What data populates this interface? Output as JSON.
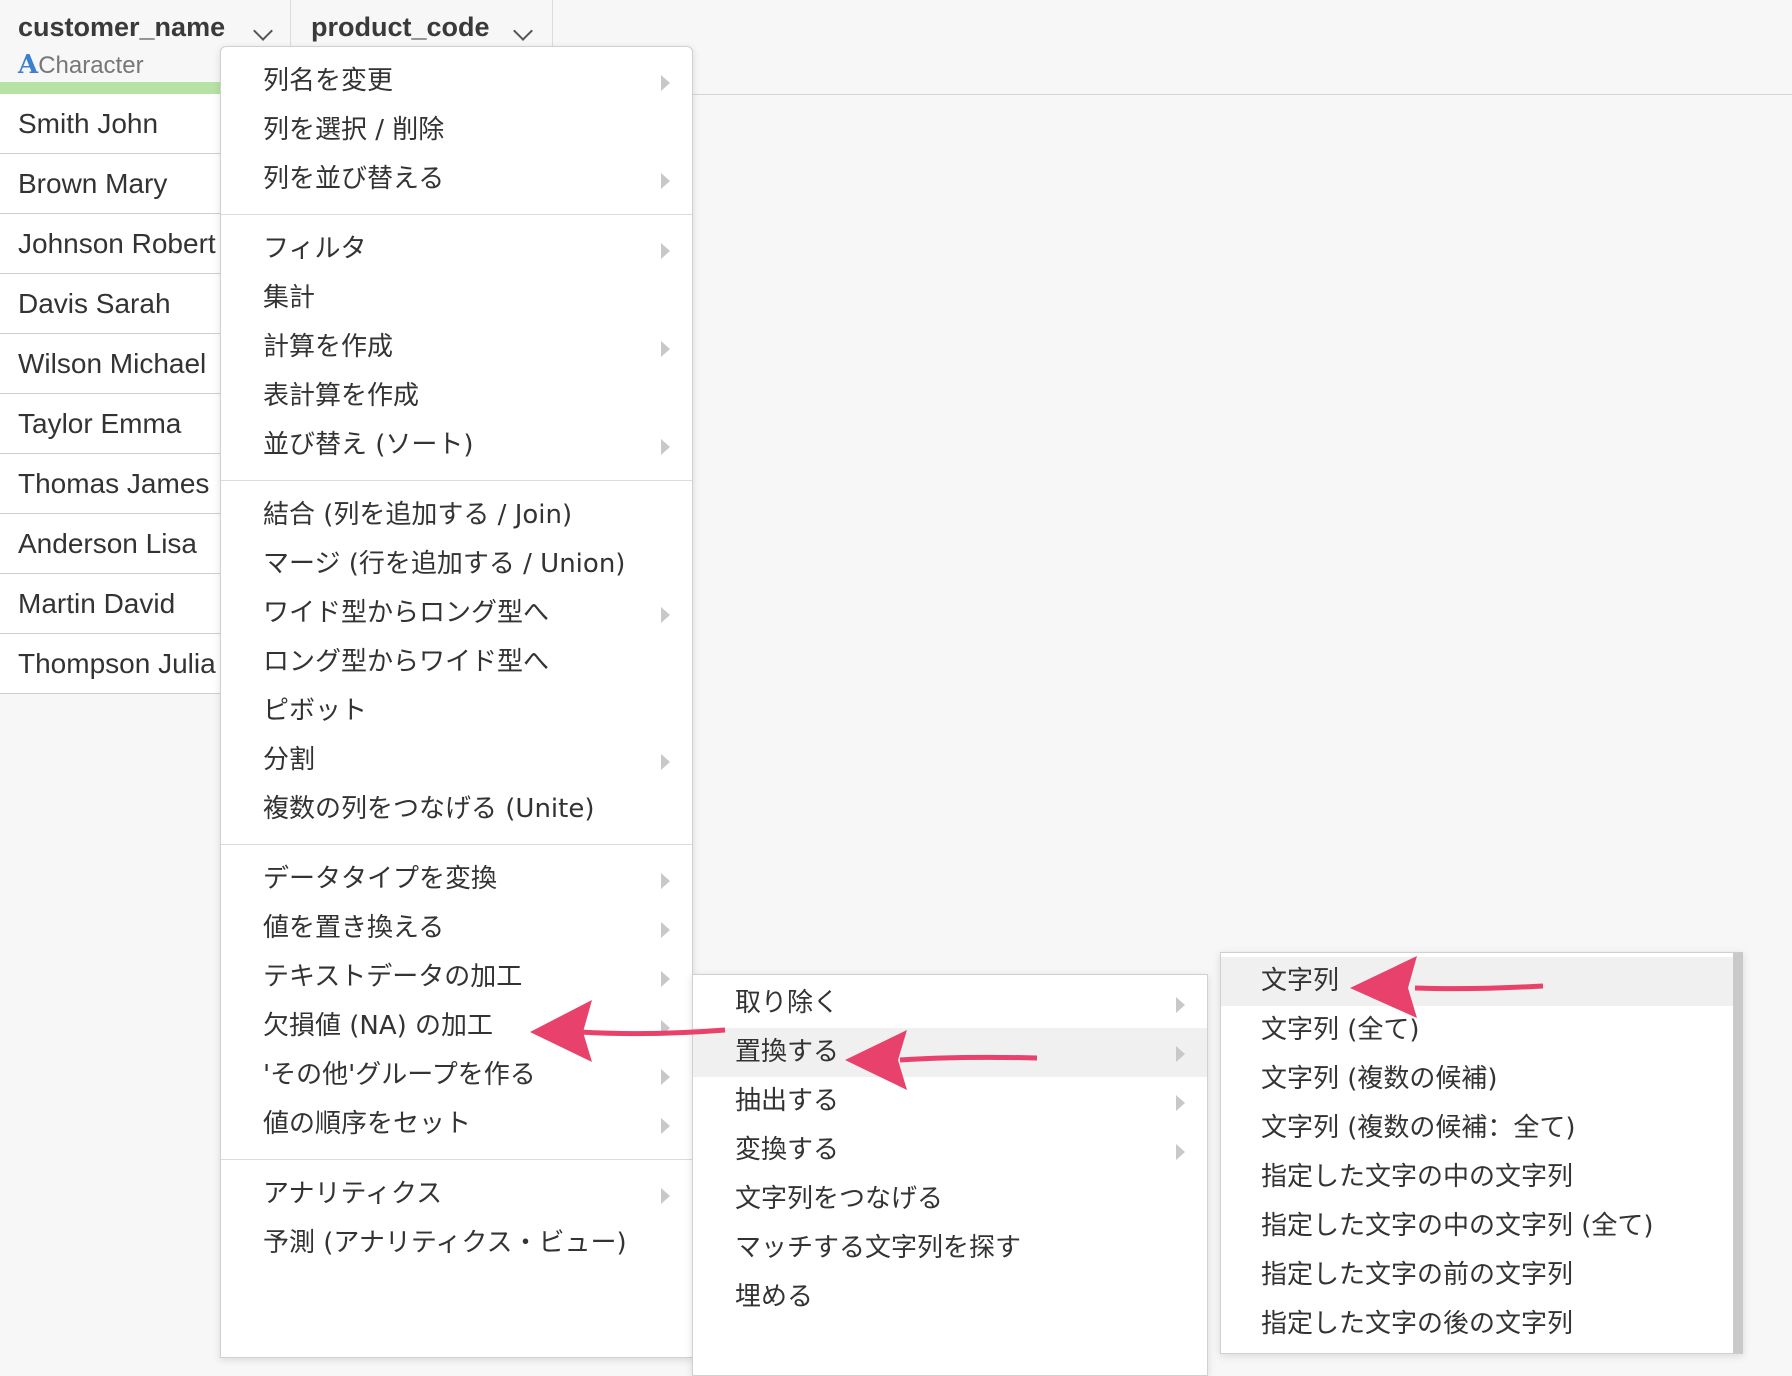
{
  "columns": [
    {
      "name": "customer_name",
      "type": "Character",
      "type_icon": "A"
    },
    {
      "name": "product_code"
    }
  ],
  "rows": [
    "Smith John",
    "Brown Mary",
    "Johnson Robert",
    "Davis Sarah",
    "Wilson Michael",
    "Taylor Emma",
    "Thomas James",
    "Anderson Lisa",
    "Martin David",
    "Thompson Julia"
  ],
  "menu1": {
    "sections": [
      [
        {
          "label": "列名を変更",
          "submenu": true
        },
        {
          "label": "列を選択 / 削除",
          "submenu": false
        },
        {
          "label": "列を並び替える",
          "submenu": true
        }
      ],
      [
        {
          "label": "フィルタ",
          "submenu": true
        },
        {
          "label": "集計",
          "submenu": false
        },
        {
          "label": "計算を作成",
          "submenu": true
        },
        {
          "label": "表計算を作成",
          "submenu": false
        },
        {
          "label": "並び替え (ソート)",
          "submenu": true
        }
      ],
      [
        {
          "label": "結合 (列を追加する / Join)",
          "submenu": false
        },
        {
          "label": "マージ (行を追加する / Union)",
          "submenu": false
        },
        {
          "label": "ワイド型からロング型へ",
          "submenu": true
        },
        {
          "label": "ロング型からワイド型へ",
          "submenu": false
        },
        {
          "label": "ピボット",
          "submenu": false
        },
        {
          "label": "分割",
          "submenu": true
        },
        {
          "label": "複数の列をつなげる (Unite)",
          "submenu": false
        }
      ],
      [
        {
          "label": "データタイプを変換",
          "submenu": true
        },
        {
          "label": "値を置き換える",
          "submenu": true
        },
        {
          "label": "テキストデータの加工",
          "submenu": true
        },
        {
          "label": "欠損値 (NA) の加工",
          "submenu": true
        },
        {
          "label": "'その他'グループを作る",
          "submenu": true
        },
        {
          "label": "値の順序をセット",
          "submenu": true
        }
      ],
      [
        {
          "label": "アナリティクス",
          "submenu": true
        },
        {
          "label": "予測 (アナリティクス・ビュー)",
          "submenu": false
        }
      ]
    ]
  },
  "menu2": [
    {
      "label": "取り除く",
      "submenu": true
    },
    {
      "label": "置換する",
      "submenu": true,
      "highlighted": true
    },
    {
      "label": "抽出する",
      "submenu": true
    },
    {
      "label": "変換する",
      "submenu": true
    },
    {
      "label": "文字列をつなげる",
      "submenu": false
    },
    {
      "label": "マッチする文字列を探す",
      "submenu": false
    },
    {
      "label": "埋める",
      "submenu": false
    }
  ],
  "menu3": [
    {
      "label": "文字列",
      "highlighted": true
    },
    {
      "label": "文字列 (全て)"
    },
    {
      "label": "文字列 (複数の候補)"
    },
    {
      "label": "文字列 (複数の候補：全て)"
    },
    {
      "label": "指定した文字の中の文字列"
    },
    {
      "label": "指定した文字の中の文字列 (全て)"
    },
    {
      "label": "指定した文字の前の文字列"
    },
    {
      "label": "指定した文字の後の文字列"
    }
  ],
  "colors": {
    "accent_arrow": "#e8416b",
    "type_icon": "#3b7fd0",
    "column_bar": "#b7e2a5"
  }
}
